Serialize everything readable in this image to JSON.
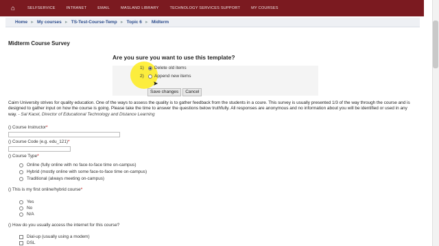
{
  "topnav": {
    "links": [
      "SELFSERVICE",
      "INTRANET",
      "EMAIL",
      "MASLAND LIBRARY",
      "TECHNOLOGY SERVICES SUPPORT",
      "MY COURSES"
    ]
  },
  "breadcrumb": [
    "Home",
    "My courses",
    "TS-Test-Course-Temp",
    "Topic 6",
    "Midterm"
  ],
  "page_title": "Midterm Course Survey",
  "template_prompt": "Are you sure you want to use this template?",
  "choices": {
    "num1": "1)",
    "label1": "Delete old items",
    "num2": "2)",
    "label2": "Append new items"
  },
  "buttons": {
    "save": "Save changes",
    "cancel": "Cancel"
  },
  "intro": {
    "text": "Cairn University strives for quality education. One of the ways to assess the quality is to gather feedback from the students in a coure. This survey is usually presented 1/3 of the way through the course and is designed to gather input on how the course is going. Please take the time to answer the questions below truthfully. All responses are anonymous and no information about you will be identified or used in any way.",
    "quote": "- Sal Kacel, Director of Educational Technology and Distance Learning"
  },
  "questions": {
    "instructor": "() Course Instructor",
    "code": "() Course Code (e.g. edu_121)",
    "type": "() Course Type",
    "type_options": [
      "Online (fully online with no face-to-face time on-campus)",
      "Hybrid (mostly online with some face-to-face time on-campus)",
      "Traditional (always meeting on-campus)"
    ],
    "first": "() This is my first online/hybrid course",
    "first_options": [
      "Yes",
      "No",
      "N/A"
    ],
    "access": "() How do you usually access the internet for this course?",
    "access_options": [
      "Dial-up (usually using a modem)",
      "DSL"
    ]
  },
  "required_mark": "*"
}
